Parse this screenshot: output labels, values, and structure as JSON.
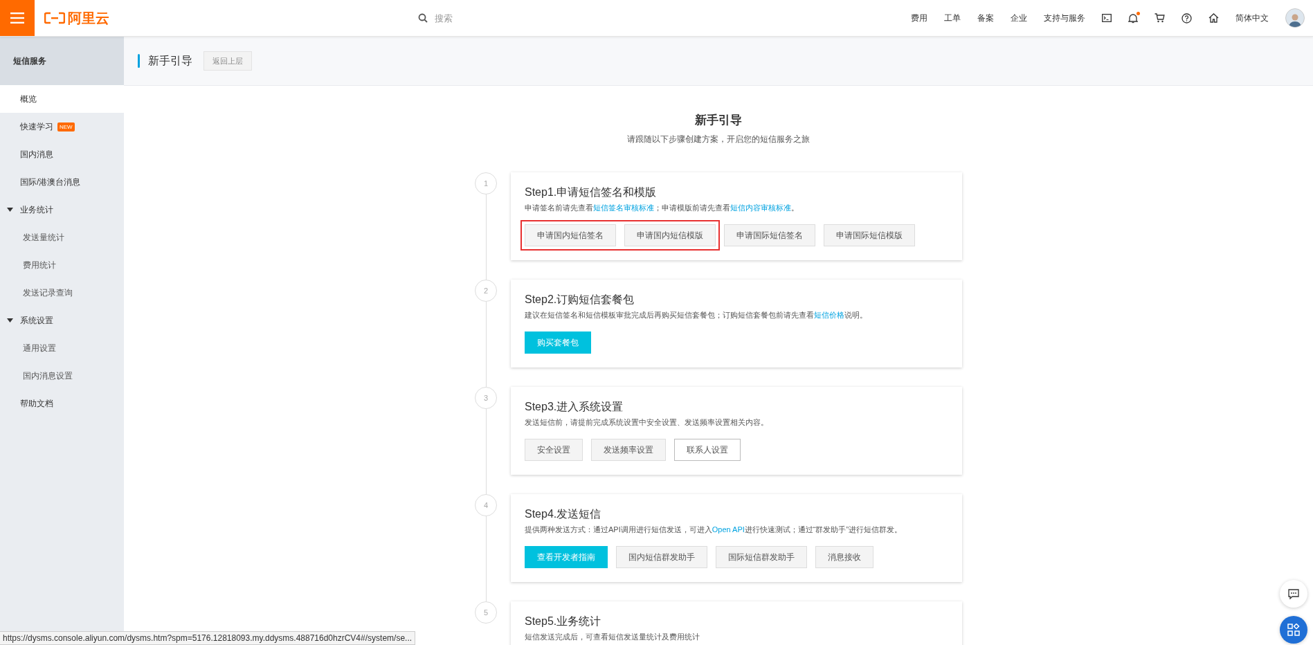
{
  "topbar": {
    "logo": "阿里云",
    "search": {
      "placeholder": "搜索"
    },
    "links": [
      "费用",
      "工单",
      "备案",
      "企业",
      "支持与服务"
    ],
    "icons": [
      {
        "kind": "terminal"
      },
      {
        "kind": "bell",
        "dot": true
      },
      {
        "kind": "cart"
      },
      {
        "kind": "help"
      },
      {
        "kind": "home"
      }
    ],
    "language": "简体中文"
  },
  "sidebar": {
    "title": "短信服务",
    "items": [
      {
        "label": "概览",
        "selected": true
      },
      {
        "label": "快速学习",
        "selected": false,
        "badge": "NEW"
      },
      {
        "label": "国内消息",
        "selected": false
      },
      {
        "label": "国际/港澳台消息",
        "selected": false
      },
      {
        "label": "业务统计",
        "selected": false,
        "expanded": true,
        "children": [
          {
            "label": "发送量统计",
            "selected": false
          },
          {
            "label": "费用统计",
            "selected": false
          },
          {
            "label": "发送记录查询",
            "selected": false
          }
        ]
      },
      {
        "label": "系统设置",
        "selected": false,
        "expanded": true,
        "children": [
          {
            "label": "通用设置",
            "selected": false
          },
          {
            "label": "国内消息设置",
            "selected": false
          }
        ]
      },
      {
        "label": "帮助文档",
        "selected": false
      }
    ]
  },
  "header": {
    "title": "新手引导",
    "back_button": "返回上层"
  },
  "guide": {
    "title": "新手引导",
    "subtitle": "请跟随以下步骤创建方案，开启您的短信服务之旅",
    "steps": [
      {
        "number": "1",
        "title": "Step1.申请短信签名和模版",
        "description": [
          {
            "text": "申请签名前请先查看"
          },
          {
            "text": "短信签名审核标准",
            "link": true
          },
          {
            "text": "；申请模版前请先查看"
          },
          {
            "text": "短信内容审核标准",
            "link": true
          },
          {
            "text": "。"
          }
        ],
        "buttons": [
          {
            "label": "申请国内短信签名",
            "kind": "default",
            "highlighted": true
          },
          {
            "label": "申请国内短信模版",
            "kind": "default",
            "highlighted": true
          },
          {
            "label": "申请国际短信签名",
            "kind": "default",
            "highlighted": false
          },
          {
            "label": "申请国际短信模版",
            "kind": "default",
            "highlighted": false
          }
        ]
      },
      {
        "number": "2",
        "title": "Step2.订购短信套餐包",
        "description": [
          {
            "text": "建议在短信签名和短信模板审批完成后再购买短信套餐包；订购短信套餐包前请先查看"
          },
          {
            "text": "短信价格",
            "link": true
          },
          {
            "text": "说明。"
          }
        ],
        "buttons": [
          {
            "label": "购买套餐包",
            "kind": "primary",
            "highlighted": false
          }
        ]
      },
      {
        "number": "3",
        "title": "Step3.进入系统设置",
        "description": [
          {
            "text": "发送短信前，请提前完成系统设置中安全设置、发送频率设置相关内容。"
          }
        ],
        "buttons": [
          {
            "label": "安全设置",
            "kind": "default",
            "highlighted": false
          },
          {
            "label": "发送频率设置",
            "kind": "default",
            "highlighted": false
          },
          {
            "label": "联系人设置",
            "kind": "outline",
            "highlighted": false
          }
        ]
      },
      {
        "number": "4",
        "title": "Step4.发送短信",
        "description": [
          {
            "text": "提供两种发送方式：通过API调用进行短信发送，可进入"
          },
          {
            "text": "Open API",
            "link": true
          },
          {
            "text": "进行快速测试；通过“群发助手”进行短信群发。"
          }
        ],
        "buttons": [
          {
            "label": "查看开发者指南",
            "kind": "primary",
            "highlighted": false
          },
          {
            "label": "国内短信群发助手",
            "kind": "default",
            "highlighted": false
          },
          {
            "label": "国际短信群发助手",
            "kind": "default",
            "highlighted": false
          },
          {
            "label": "消息接收",
            "kind": "default",
            "highlighted": false
          }
        ]
      },
      {
        "number": "5",
        "title": "Step5.业务统计",
        "description": [
          {
            "text": "短信发送完成后，可查看短信发送量统计及费用统计"
          }
        ]
      }
    ]
  },
  "status_url": "https://dysms.console.aliyun.com/dysms.htm?spm=5176.12818093.my.ddysms.488716d0hzrCV4#/system/se..."
}
